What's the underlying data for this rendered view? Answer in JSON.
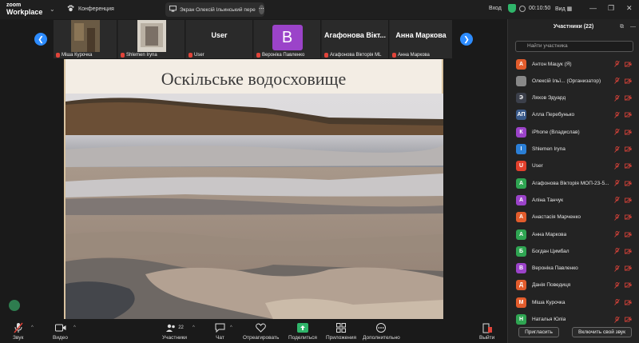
{
  "app": {
    "logo_line1": "zoom",
    "logo_line2": "Workplace"
  },
  "top": {
    "conference_label": "Конференция",
    "screen_pill": "Экран Олексій Ільинський пере",
    "enter_label": "Вход",
    "timer": "00:10:50",
    "view_label": "Вид"
  },
  "thumbs": [
    {
      "name": "Міша Курочка",
      "type": "video"
    },
    {
      "name": "Shlemen Iryna",
      "type": "video"
    },
    {
      "name": "User",
      "type": "name",
      "big": "User"
    },
    {
      "name": "Вероніка Павленко",
      "type": "avatar",
      "letter": "В"
    },
    {
      "name": "Агафонова Вікторія МL",
      "type": "name",
      "big": "Агафонова Вікт..."
    },
    {
      "name": "Анна Маркова",
      "type": "name",
      "big": "Анна Маркова"
    }
  ],
  "slide": {
    "title": "Оскільське водосховище"
  },
  "sidebar": {
    "title": "Участники (22)",
    "search_placeholder": "Найти участника",
    "participants": [
      {
        "initial": "А",
        "name": "Антон Мацук (Я)",
        "color": "#e25c2c"
      },
      {
        "initial": "",
        "name": "Олексій Ільї... (Организатор)",
        "color": "#888888"
      },
      {
        "initial": "Э",
        "name": "Ляхов Эдуард",
        "color": "#3b3f4a"
      },
      {
        "initial": "АП",
        "name": "Алла Перебунько",
        "color": "#3a5a8a"
      },
      {
        "initial": "К",
        "name": "iPhone (Владислав)",
        "color": "#9b43c9"
      },
      {
        "initial": "I",
        "name": "Shlemen Iryna",
        "color": "#2b7fd6"
      },
      {
        "initial": "U",
        "name": "User",
        "color": "#e2402c"
      },
      {
        "initial": "А",
        "name": "Агафонова Вікторія МОП-23-5...",
        "color": "#2fa552"
      },
      {
        "initial": "А",
        "name": "Аліна Танчук",
        "color": "#9b43c9"
      },
      {
        "initial": "А",
        "name": "Анастасія Марченко",
        "color": "#e25c2c"
      },
      {
        "initial": "А",
        "name": "Анна Маркова",
        "color": "#2fa552"
      },
      {
        "initial": "Б",
        "name": "Богдан Цимбал",
        "color": "#2fa552"
      },
      {
        "initial": "В",
        "name": "Вероніка Павленко",
        "color": "#9b43c9"
      },
      {
        "initial": "Д",
        "name": "Данія Поведиця",
        "color": "#e25c2c"
      },
      {
        "initial": "М",
        "name": "Міша Курочка",
        "color": "#e25c2c"
      },
      {
        "initial": "Н",
        "name": "Наталья Юліа",
        "color": "#2fa552"
      }
    ],
    "invite_label": "Пригласить",
    "unmute_label": "Включить свой звук"
  },
  "toolbar": {
    "audio": "Звук",
    "video": "Видео",
    "participants": "Участники",
    "participants_count": "22",
    "chat": "Чат",
    "react": "Отреагировать",
    "share": "Поделиться",
    "apps": "Приложения",
    "more": "Дополнительно",
    "leave": "Выйти"
  },
  "colors": {
    "accent": "#2d8cff",
    "share_green": "#2fb56a",
    "danger": "#e0443a"
  }
}
